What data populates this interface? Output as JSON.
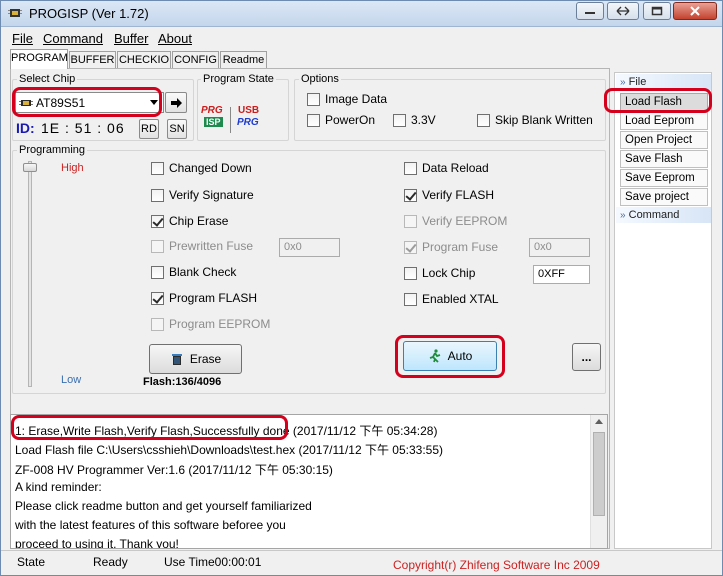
{
  "window": {
    "title": "PROGISP (Ver 1.72)"
  },
  "menu": [
    "File",
    "Command",
    "Buffer",
    "About"
  ],
  "tabs": [
    "PROGRAM",
    "BUFFER",
    "CHECKIO",
    "CONFIG",
    "Readme"
  ],
  "select_chip": {
    "label": "Select Chip",
    "value": "AT89S51"
  },
  "id": {
    "label": "ID:",
    "value": "1E : 51 : 06",
    "rd_label": "RD",
    "sn_label": "SN"
  },
  "program_state": {
    "label": "Program State",
    "prg_text": "PRG",
    "isp_text": "ISP",
    "usb_text": "USB",
    "prg2_text": "PRG"
  },
  "options": {
    "label": "Options",
    "image_data": "Image Data",
    "power_on": "PowerOn",
    "v33": "3.3V",
    "skip_blank": "Skip Blank Written"
  },
  "programming": {
    "label": "Programming",
    "high": "High",
    "low": "Low",
    "left": [
      {
        "label": "Changed Down",
        "checked": false,
        "disabled": false
      },
      {
        "label": "Verify Signature",
        "checked": false,
        "disabled": false
      },
      {
        "label": "Chip Erase",
        "checked": true,
        "disabled": false
      },
      {
        "label": "Prewritten Fuse",
        "checked": false,
        "disabled": true
      },
      {
        "label": "Blank Check",
        "checked": false,
        "disabled": false
      },
      {
        "label": "Program FLASH",
        "checked": true,
        "disabled": false
      },
      {
        "label": "Program EEPROM",
        "checked": false,
        "disabled": true
      }
    ],
    "right": [
      {
        "label": "Data Reload",
        "checked": false,
        "disabled": false
      },
      {
        "label": "Verify FLASH",
        "checked": true,
        "disabled": false
      },
      {
        "label": "Verify EEPROM",
        "checked": false,
        "disabled": true
      },
      {
        "label": "Program Fuse",
        "checked": true,
        "disabled": true
      },
      {
        "label": "Lock Chip",
        "checked": false,
        "disabled": false
      },
      {
        "label": "Enabled XTAL",
        "checked": false,
        "disabled": false
      }
    ],
    "prewritten_fuse_value": "0x0",
    "program_fuse_value": "0x0",
    "lock_chip_value": "0XFF",
    "erase_label": "Erase",
    "auto_label": "Auto",
    "more_label": "...",
    "flash_info": "Flash:136/4096"
  },
  "log": [
    "1: Erase,Write Flash,Verify Flash,Successfully done",
    "(2017/11/12 下午 05:34:28)",
    "Load Flash file C:\\Users\\csshieh\\Downloads\\test.hex (2017/11/12 下午 05:33:55)",
    "ZF-008 HV Programmer Ver:1.6 (2017/11/12 下午 05:30:15)",
    "A kind reminder:",
    "Please click readme button and get yourself familiarized",
    "with the latest features of this software beforee you",
    "proceed to using it. Thank you!"
  ],
  "status": {
    "state_label": "State",
    "state_value": "Ready",
    "use_time": "Use Time00:00:01",
    "copyright": "Copyright(r) Zhifeng Software Inc 2009"
  },
  "side": {
    "file_header": "File",
    "buttons": [
      "Load Flash",
      "Load Eeprom",
      "Open Project",
      "Save Flash",
      "Save Eeprom",
      "Save project"
    ],
    "command_header": "Command"
  },
  "colors": {
    "accent_red": "#d5001c",
    "id_blue": "#1a1ab3",
    "high_red": "#cc2222",
    "low_blue": "#3a6fb0"
  }
}
